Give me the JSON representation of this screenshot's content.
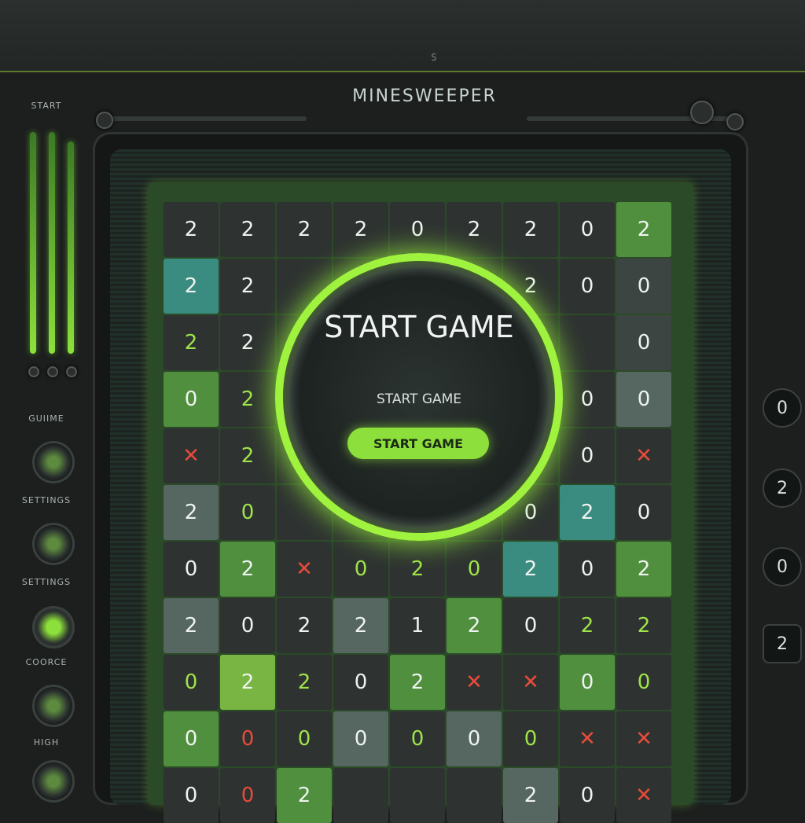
{
  "header": {
    "title": "MINESWEEPER",
    "top_icon_text": "S"
  },
  "sidebar": {
    "start_label": "START",
    "game_label": "GUIIME",
    "settings_label_1": "SETTINGS",
    "settings_label_2": "SETTINGS",
    "scores_label": "COORCE",
    "high_label": "HIGH"
  },
  "overlay": {
    "title": "START GAME",
    "subtitle": "START GAME",
    "button_label": "START GAME"
  },
  "right_panel": [
    "0",
    "2",
    "0",
    "2"
  ],
  "board": {
    "cells": [
      {
        "v": "2",
        "s": "c-dark",
        "t": "t-white"
      },
      {
        "v": "2",
        "s": "c-dark",
        "t": "t-white"
      },
      {
        "v": "2",
        "s": "c-dark",
        "t": "t-white"
      },
      {
        "v": "2",
        "s": "c-dark",
        "t": "t-white"
      },
      {
        "v": "0",
        "s": "c-dark",
        "t": "t-white"
      },
      {
        "v": "2",
        "s": "c-dark",
        "t": "t-white"
      },
      {
        "v": "2",
        "s": "c-dark",
        "t": "t-white"
      },
      {
        "v": "0",
        "s": "c-dark",
        "t": "t-white"
      },
      {
        "v": "2",
        "s": "c-green",
        "t": "t-white"
      },
      {
        "v": "2",
        "s": "c-teal",
        "t": "t-white"
      },
      {
        "v": "2",
        "s": "c-dark",
        "t": "t-white"
      },
      {
        "v": "",
        "s": "c-dark",
        "t": "t-white"
      },
      {
        "v": "",
        "s": "c-dark",
        "t": "t-white"
      },
      {
        "v": "",
        "s": "c-dark",
        "t": "t-white"
      },
      {
        "v": "",
        "s": "c-dark",
        "t": "t-white"
      },
      {
        "v": "2",
        "s": "c-dark",
        "t": "t-white"
      },
      {
        "v": "0",
        "s": "c-dark",
        "t": "t-white"
      },
      {
        "v": "0",
        "s": "c-gray",
        "t": "t-white"
      },
      {
        "v": "2",
        "s": "c-dark",
        "t": "t-green"
      },
      {
        "v": "2",
        "s": "c-dark",
        "t": "t-white"
      },
      {
        "v": "",
        "s": "c-dark",
        "t": "t-white"
      },
      {
        "v": "",
        "s": "c-dark",
        "t": "t-white"
      },
      {
        "v": "",
        "s": "c-dark",
        "t": "t-white"
      },
      {
        "v": "",
        "s": "c-dark",
        "t": "t-white"
      },
      {
        "v": "",
        "s": "c-dark",
        "t": "t-white"
      },
      {
        "v": "",
        "s": "c-dark",
        "t": "t-white"
      },
      {
        "v": "0",
        "s": "c-gray",
        "t": "t-white"
      },
      {
        "v": "0",
        "s": "c-green",
        "t": "t-white"
      },
      {
        "v": "2",
        "s": "c-dark",
        "t": "t-green"
      },
      {
        "v": "",
        "s": "c-dark",
        "t": "t-white"
      },
      {
        "v": "",
        "s": "c-dark",
        "t": "t-white"
      },
      {
        "v": "",
        "s": "c-dark",
        "t": "t-white"
      },
      {
        "v": "",
        "s": "c-dark",
        "t": "t-white"
      },
      {
        "v": "",
        "s": "c-dark",
        "t": "t-white"
      },
      {
        "v": "0",
        "s": "c-dark",
        "t": "t-white"
      },
      {
        "v": "0",
        "s": "c-slate",
        "t": "t-white"
      },
      {
        "v": "✕",
        "s": "c-dark",
        "t": "t-red"
      },
      {
        "v": "2",
        "s": "c-dark",
        "t": "t-green"
      },
      {
        "v": "",
        "s": "c-dark",
        "t": "t-white"
      },
      {
        "v": "",
        "s": "c-dark",
        "t": "t-white"
      },
      {
        "v": "",
        "s": "c-dark",
        "t": "t-white"
      },
      {
        "v": "",
        "s": "c-dark",
        "t": "t-white"
      },
      {
        "v": "",
        "s": "c-dark",
        "t": "t-white"
      },
      {
        "v": "0",
        "s": "c-dark",
        "t": "t-white"
      },
      {
        "v": "✕",
        "s": "c-dark",
        "t": "t-red"
      },
      {
        "v": "2",
        "s": "c-slate",
        "t": "t-white"
      },
      {
        "v": "0",
        "s": "c-dark",
        "t": "t-green"
      },
      {
        "v": "",
        "s": "c-dark",
        "t": "t-white"
      },
      {
        "v": "",
        "s": "c-dark",
        "t": "t-white"
      },
      {
        "v": "",
        "s": "c-dark",
        "t": "t-white"
      },
      {
        "v": "",
        "s": "c-dark",
        "t": "t-white"
      },
      {
        "v": "0",
        "s": "c-dark",
        "t": "t-white"
      },
      {
        "v": "2",
        "s": "c-teal",
        "t": "t-white"
      },
      {
        "v": "0",
        "s": "c-dark",
        "t": "t-white"
      },
      {
        "v": "0",
        "s": "c-dark",
        "t": "t-white"
      },
      {
        "v": "2",
        "s": "c-green",
        "t": "t-white"
      },
      {
        "v": "✕",
        "s": "c-dark",
        "t": "t-red"
      },
      {
        "v": "0",
        "s": "c-dark",
        "t": "t-green"
      },
      {
        "v": "2",
        "s": "c-dark",
        "t": "t-green"
      },
      {
        "v": "0",
        "s": "c-dark",
        "t": "t-green"
      },
      {
        "v": "2",
        "s": "c-teal",
        "t": "t-white"
      },
      {
        "v": "0",
        "s": "c-dark",
        "t": "t-white"
      },
      {
        "v": "2",
        "s": "c-green",
        "t": "t-white"
      },
      {
        "v": "2",
        "s": "c-slate",
        "t": "t-white"
      },
      {
        "v": "0",
        "s": "c-dark",
        "t": "t-white"
      },
      {
        "v": "2",
        "s": "c-dark",
        "t": "t-white"
      },
      {
        "v": "2",
        "s": "c-slate",
        "t": "t-white"
      },
      {
        "v": "1",
        "s": "c-dark",
        "t": "t-white"
      },
      {
        "v": "2",
        "s": "c-green",
        "t": "t-white"
      },
      {
        "v": "0",
        "s": "c-dark",
        "t": "t-white"
      },
      {
        "v": "2",
        "s": "c-dark",
        "t": "t-green"
      },
      {
        "v": "2",
        "s": "c-dark",
        "t": "t-green"
      },
      {
        "v": "0",
        "s": "c-dark",
        "t": "t-green"
      },
      {
        "v": "2",
        "s": "c-lgreen",
        "t": "t-white"
      },
      {
        "v": "2",
        "s": "c-dark",
        "t": "t-green"
      },
      {
        "v": "0",
        "s": "c-dark",
        "t": "t-white"
      },
      {
        "v": "2",
        "s": "c-green",
        "t": "t-white"
      },
      {
        "v": "✕",
        "s": "c-dark",
        "t": "t-red"
      },
      {
        "v": "✕",
        "s": "c-dark",
        "t": "t-red"
      },
      {
        "v": "0",
        "s": "c-green",
        "t": "t-white"
      },
      {
        "v": "0",
        "s": "c-dark",
        "t": "t-green"
      },
      {
        "v": "0",
        "s": "c-green",
        "t": "t-white"
      },
      {
        "v": "0",
        "s": "c-dark",
        "t": "t-red"
      },
      {
        "v": "0",
        "s": "c-dark",
        "t": "t-green"
      },
      {
        "v": "0",
        "s": "c-slate",
        "t": "t-white"
      },
      {
        "v": "0",
        "s": "c-dark",
        "t": "t-green"
      },
      {
        "v": "0",
        "s": "c-slate",
        "t": "t-white"
      },
      {
        "v": "0",
        "s": "c-dark",
        "t": "t-green"
      },
      {
        "v": "✕",
        "s": "c-dark",
        "t": "t-red"
      },
      {
        "v": "✕",
        "s": "c-dark",
        "t": "t-red"
      },
      {
        "v": "0",
        "s": "c-dark",
        "t": "t-white"
      },
      {
        "v": "0",
        "s": "c-dark",
        "t": "t-red"
      },
      {
        "v": "2",
        "s": "c-green",
        "t": "t-white"
      },
      {
        "v": "",
        "s": "c-dark",
        "t": "t-white"
      },
      {
        "v": "",
        "s": "c-dark",
        "t": "t-white"
      },
      {
        "v": "",
        "s": "c-dark",
        "t": "t-white"
      },
      {
        "v": "2",
        "s": "c-slate",
        "t": "t-white"
      },
      {
        "v": "0",
        "s": "c-dark",
        "t": "t-white"
      },
      {
        "v": "✕",
        "s": "c-dark",
        "t": "t-red"
      }
    ]
  }
}
